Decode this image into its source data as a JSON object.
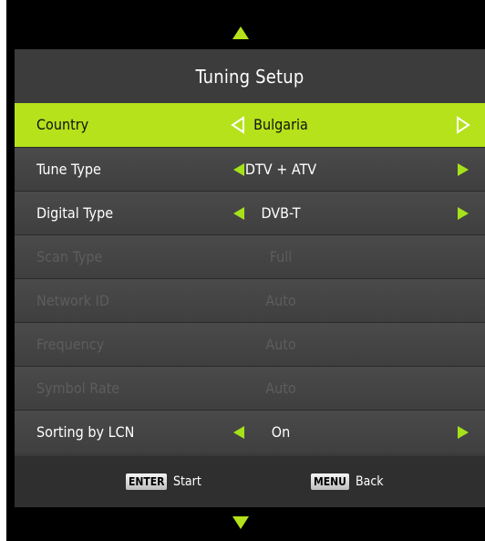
{
  "menu": {
    "title": "Tuning Setup",
    "rows": [
      {
        "label": "Country",
        "value": "Bulgaria"
      },
      {
        "label": "Tune Type",
        "value": "DTV + ATV"
      },
      {
        "label": "Digital Type",
        "value": "DVB-T"
      },
      {
        "label": "Scan Type",
        "value": "Full"
      },
      {
        "label": "Network ID",
        "value": "Auto"
      },
      {
        "label": "Frequency",
        "value": "Auto"
      },
      {
        "label": "Symbol Rate",
        "value": "Auto"
      },
      {
        "label": "Sorting by LCN",
        "value": "On"
      }
    ]
  },
  "footer": {
    "enter_key": "ENTER",
    "enter_label": "Start",
    "menu_key": "MENU",
    "menu_label": "Back"
  },
  "colors": {
    "accent": "#b5e21a",
    "panel": "#3a3a3a",
    "disabled_text": "#5d5d5d"
  },
  "icons": {
    "scroll_up": "triangle-up-icon",
    "scroll_down": "triangle-down-icon",
    "left": "triangle-left-icon",
    "right": "triangle-right-icon"
  }
}
